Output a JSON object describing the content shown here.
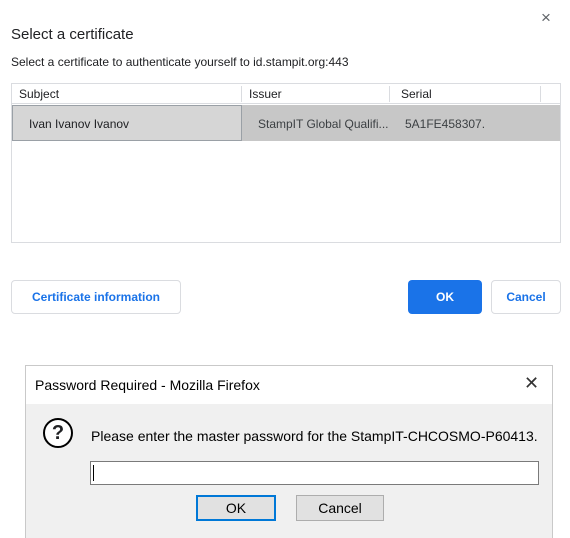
{
  "cert_dialog": {
    "close_glyph": "×",
    "title": "Select a certificate",
    "description": "Select a certificate to authenticate yourself to id.stampit.org:443",
    "columns": [
      "Subject",
      "Issuer",
      "Serial"
    ],
    "rows": [
      {
        "subject": "Ivan Ivanov Ivanov",
        "issuer": "StampIT Global Qualifi...",
        "serial": "5A1FE458307."
      }
    ],
    "info_button": "Certificate information",
    "ok_button": "OK",
    "cancel_button": "Cancel",
    "colors": {
      "accent": "#1a73e8",
      "selected_row": "#c7c7c7"
    }
  },
  "firefox_dialog": {
    "title": "Password Required - Mozilla Firefox",
    "close_glyph": "✕",
    "question_glyph": "?",
    "message": "Please enter the master password for the StampIT-CHCOSMO-P60413.",
    "password_value": "",
    "ok_button": "OK",
    "cancel_button": "Cancel",
    "colors": {
      "focus_border": "#0078d7",
      "background": "#f0f0f0"
    }
  }
}
